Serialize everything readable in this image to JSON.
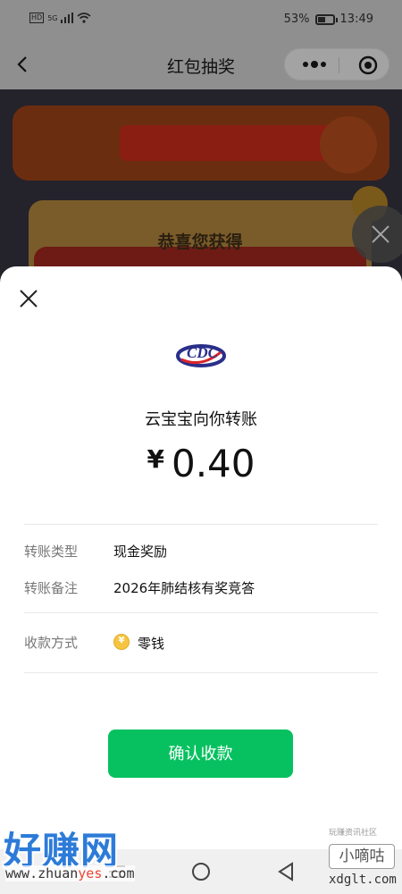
{
  "status_bar": {
    "network_tag": "HD",
    "signal_tag": "5G",
    "battery_percent": "53%",
    "battery_level": 0.53,
    "time": "13:49"
  },
  "nav": {
    "title": "红包抽奖"
  },
  "background": {
    "card_title": "恭喜您获得"
  },
  "transfer": {
    "payer_line": "云宝宝向你转账",
    "currency_symbol": "¥",
    "amount": "0.40",
    "details": [
      {
        "label": "转账类型",
        "value": "现金奖励"
      },
      {
        "label": "转账备注",
        "value": "2026年肺结核有奖竞答"
      }
    ],
    "payment_method": {
      "label": "收款方式",
      "value": "零钱",
      "icon": "coin-icon"
    },
    "confirm_label": "确认收款"
  },
  "watermarks": {
    "left_big": "好赚网",
    "left_url_pre": "www.zhuan",
    "left_url_accent": "yes",
    "left_url_post": ".com",
    "right_small": "玩赚资讯社区",
    "right_box": "小嘀咕",
    "right_domain": "xdglt.com"
  },
  "colors": {
    "accent": "#07c160",
    "nav_overlay": "#8f8f8f",
    "sheet": "#ffffff"
  }
}
